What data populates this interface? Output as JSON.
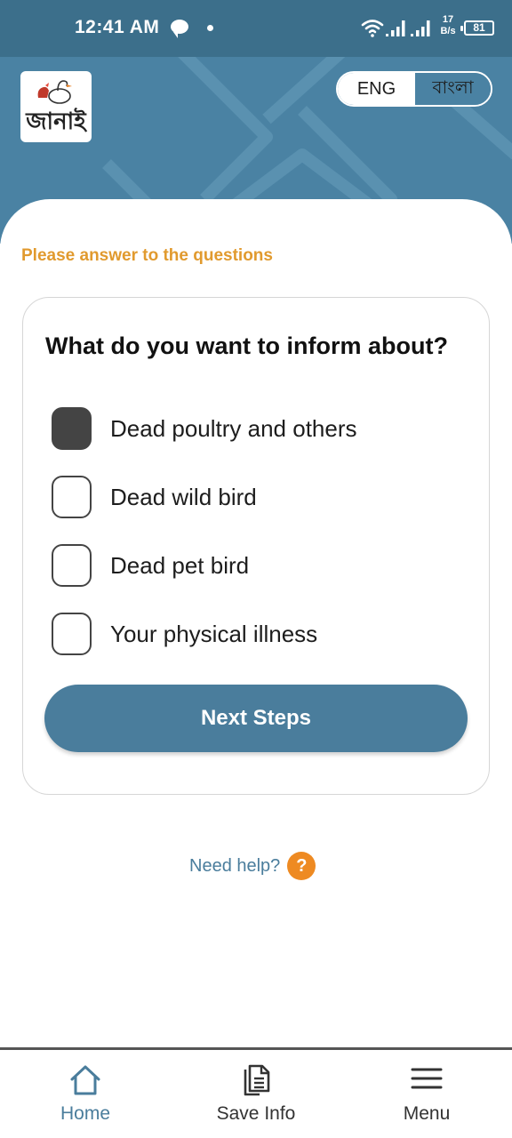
{
  "status_bar": {
    "time": "12:41 AM",
    "net_speed_value": "17",
    "net_speed_unit": "B/s",
    "battery": "81"
  },
  "header": {
    "logo_text": "জানাই",
    "lang_options": [
      "ENG",
      "বাংলা"
    ],
    "lang_selected": "ENG"
  },
  "form": {
    "instruction": "Please answer to the questions",
    "question": "What do you want to inform about?",
    "options": [
      {
        "label": "Dead poultry and others",
        "checked": true
      },
      {
        "label": "Dead wild bird",
        "checked": false
      },
      {
        "label": "Dead pet bird",
        "checked": false
      },
      {
        "label": "Your physical illness",
        "checked": false
      }
    ],
    "next_label": "Next Steps"
  },
  "help": {
    "label": "Need help?",
    "icon": "?"
  },
  "bottom_nav": {
    "items": [
      {
        "label": "Home",
        "icon": "home-icon",
        "active": true
      },
      {
        "label": "Save Info",
        "icon": "document-icon",
        "active": false
      },
      {
        "label": "Menu",
        "icon": "menu-icon",
        "active": false
      }
    ]
  },
  "colors": {
    "header": "#4a82a3",
    "status_bar": "#3c6f8b",
    "accent": "#4a7d9c",
    "instruction": "#e19a2e",
    "help_icon": "#ee8a22"
  }
}
